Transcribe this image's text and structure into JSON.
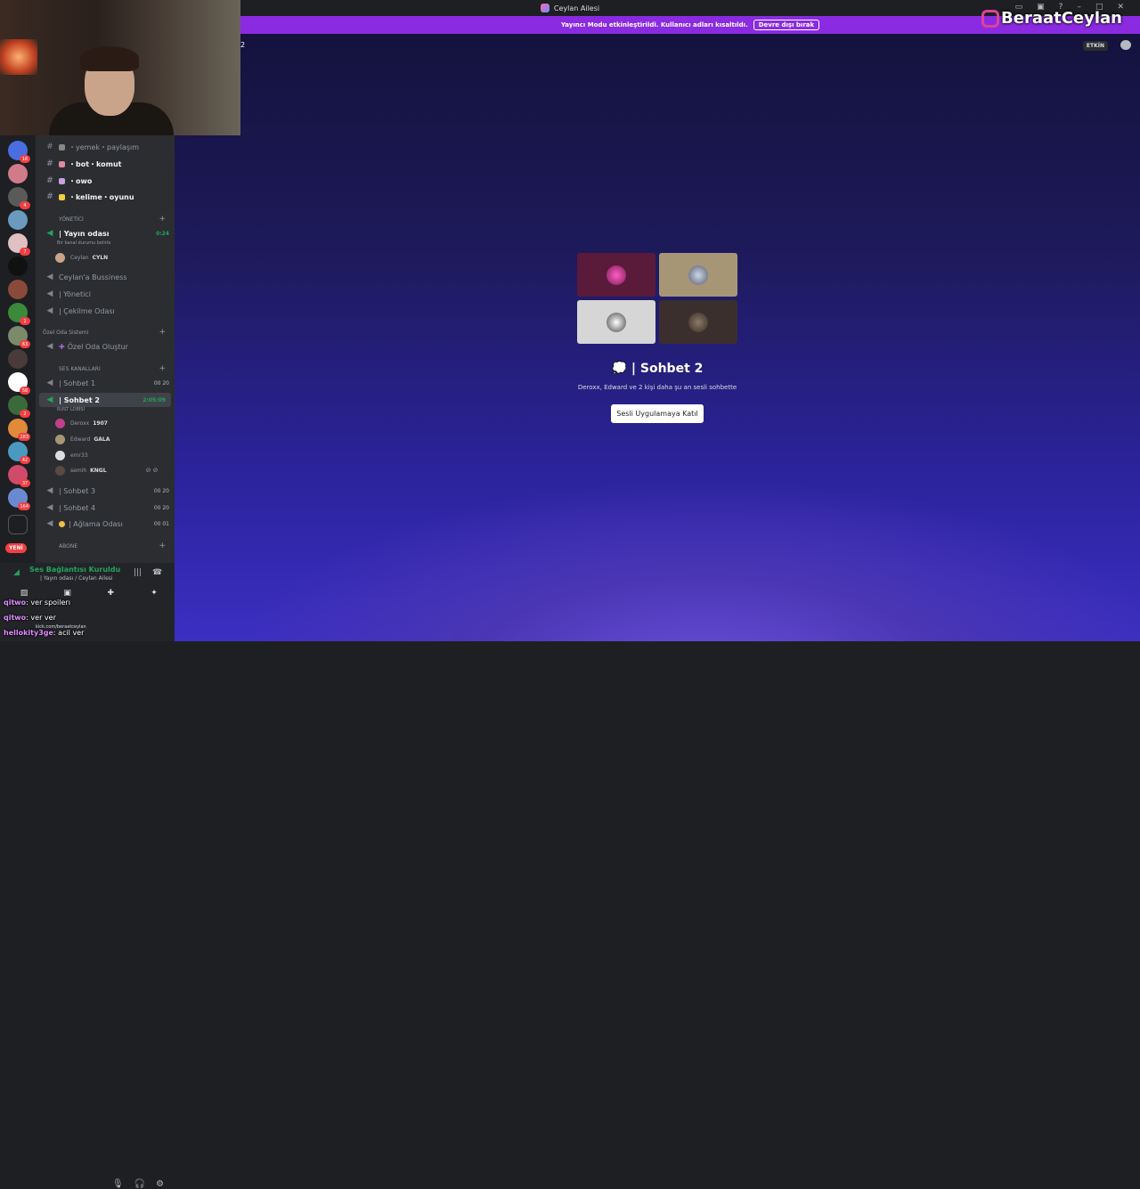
{
  "window": {
    "title": "Ceylan Ailesi"
  },
  "banner": {
    "text": "Yayıncı Modu etkinleştirildi. Kullanıcı adları kısaltıldı.",
    "button": "Devre dışı bırak"
  },
  "header": {
    "number": "2",
    "status": "ETKİN"
  },
  "watermark": {
    "text": "BeraatCeylan"
  },
  "sidebar": {
    "channels": [
      {
        "name": "・yemek・paylaşım"
      },
      {
        "name": "・bot・komut"
      },
      {
        "name": "・owo"
      },
      {
        "name": "・kelime・oyunu"
      }
    ],
    "categories": {
      "yonetici": "YÖNETİCİ",
      "ozel": "Özel Oda Sistemi",
      "ses": "SES KANALLARI",
      "abone": "ABONE"
    },
    "yayin": {
      "name": "| Yayın odası",
      "time": "0:24",
      "status": "Bir kanal durumu belirle"
    },
    "yayin_user": {
      "name": "Ceylan",
      "tag": "CYLN"
    },
    "voice": [
      {
        "name": "Ceylan'a Bussiness"
      },
      {
        "name": "| Yönetici"
      },
      {
        "name": "| Çekilme Odası"
      }
    ],
    "ozel_create": "Özel Oda Oluştur",
    "sohbet1": {
      "name": "| Sohbet 1",
      "count": "00 20"
    },
    "sohbet2": {
      "name": "| Sohbet 2",
      "time": "2:05:09",
      "status": "RUST LOBİSİ"
    },
    "sohbet2_users": [
      {
        "name": "Deroxx",
        "tag": "1907"
      },
      {
        "name": "Edward",
        "tag": "GALA"
      },
      {
        "name": "emr33",
        "tag": ""
      },
      {
        "name": "semih",
        "tag": "KNGL"
      }
    ],
    "sohbet3": {
      "name": "| Sohbet 3",
      "count": "00 20"
    },
    "sohbet4": {
      "name": "| Sohbet 4",
      "count": "00 20"
    },
    "aglama": {
      "name": "| Ağlama Odası",
      "count": "00 01"
    },
    "yeni_label": "YENİ"
  },
  "servers": [
    {
      "badge": "16"
    },
    {
      "badge": ""
    },
    {
      "badge": "4"
    },
    {
      "badge": ""
    },
    {
      "badge": "7"
    },
    {
      "badge": ""
    },
    {
      "badge": ""
    },
    {
      "badge": "1"
    },
    {
      "badge": "63"
    },
    {
      "badge": ""
    },
    {
      "badge": "58"
    },
    {
      "badge": "2"
    },
    {
      "badge": "283"
    },
    {
      "badge": "42"
    },
    {
      "badge": "37"
    },
    {
      "badge": "164"
    },
    {
      "badge": ""
    }
  ],
  "voice_panel": {
    "status": "Ses Bağlantısı Kuruldu",
    "location": "| Yayın odası / Ceylan Ailesi"
  },
  "main": {
    "channel_title": "| Sohbet 2",
    "subtitle": "Deroxx, Edward ve 2 kişi daha şu an sesli sohbette",
    "join_button": "Sesli Uygulamaya Katıl"
  },
  "chat_overlay": [
    {
      "user": "qitwo",
      "text": ": ver spoilerı"
    },
    {
      "user": "qitwo",
      "text": ": ver ver"
    },
    {
      "user": "hellokity3ge",
      "text": ": acil ver"
    }
  ],
  "link_text": "kick.com/beraatceylan"
}
